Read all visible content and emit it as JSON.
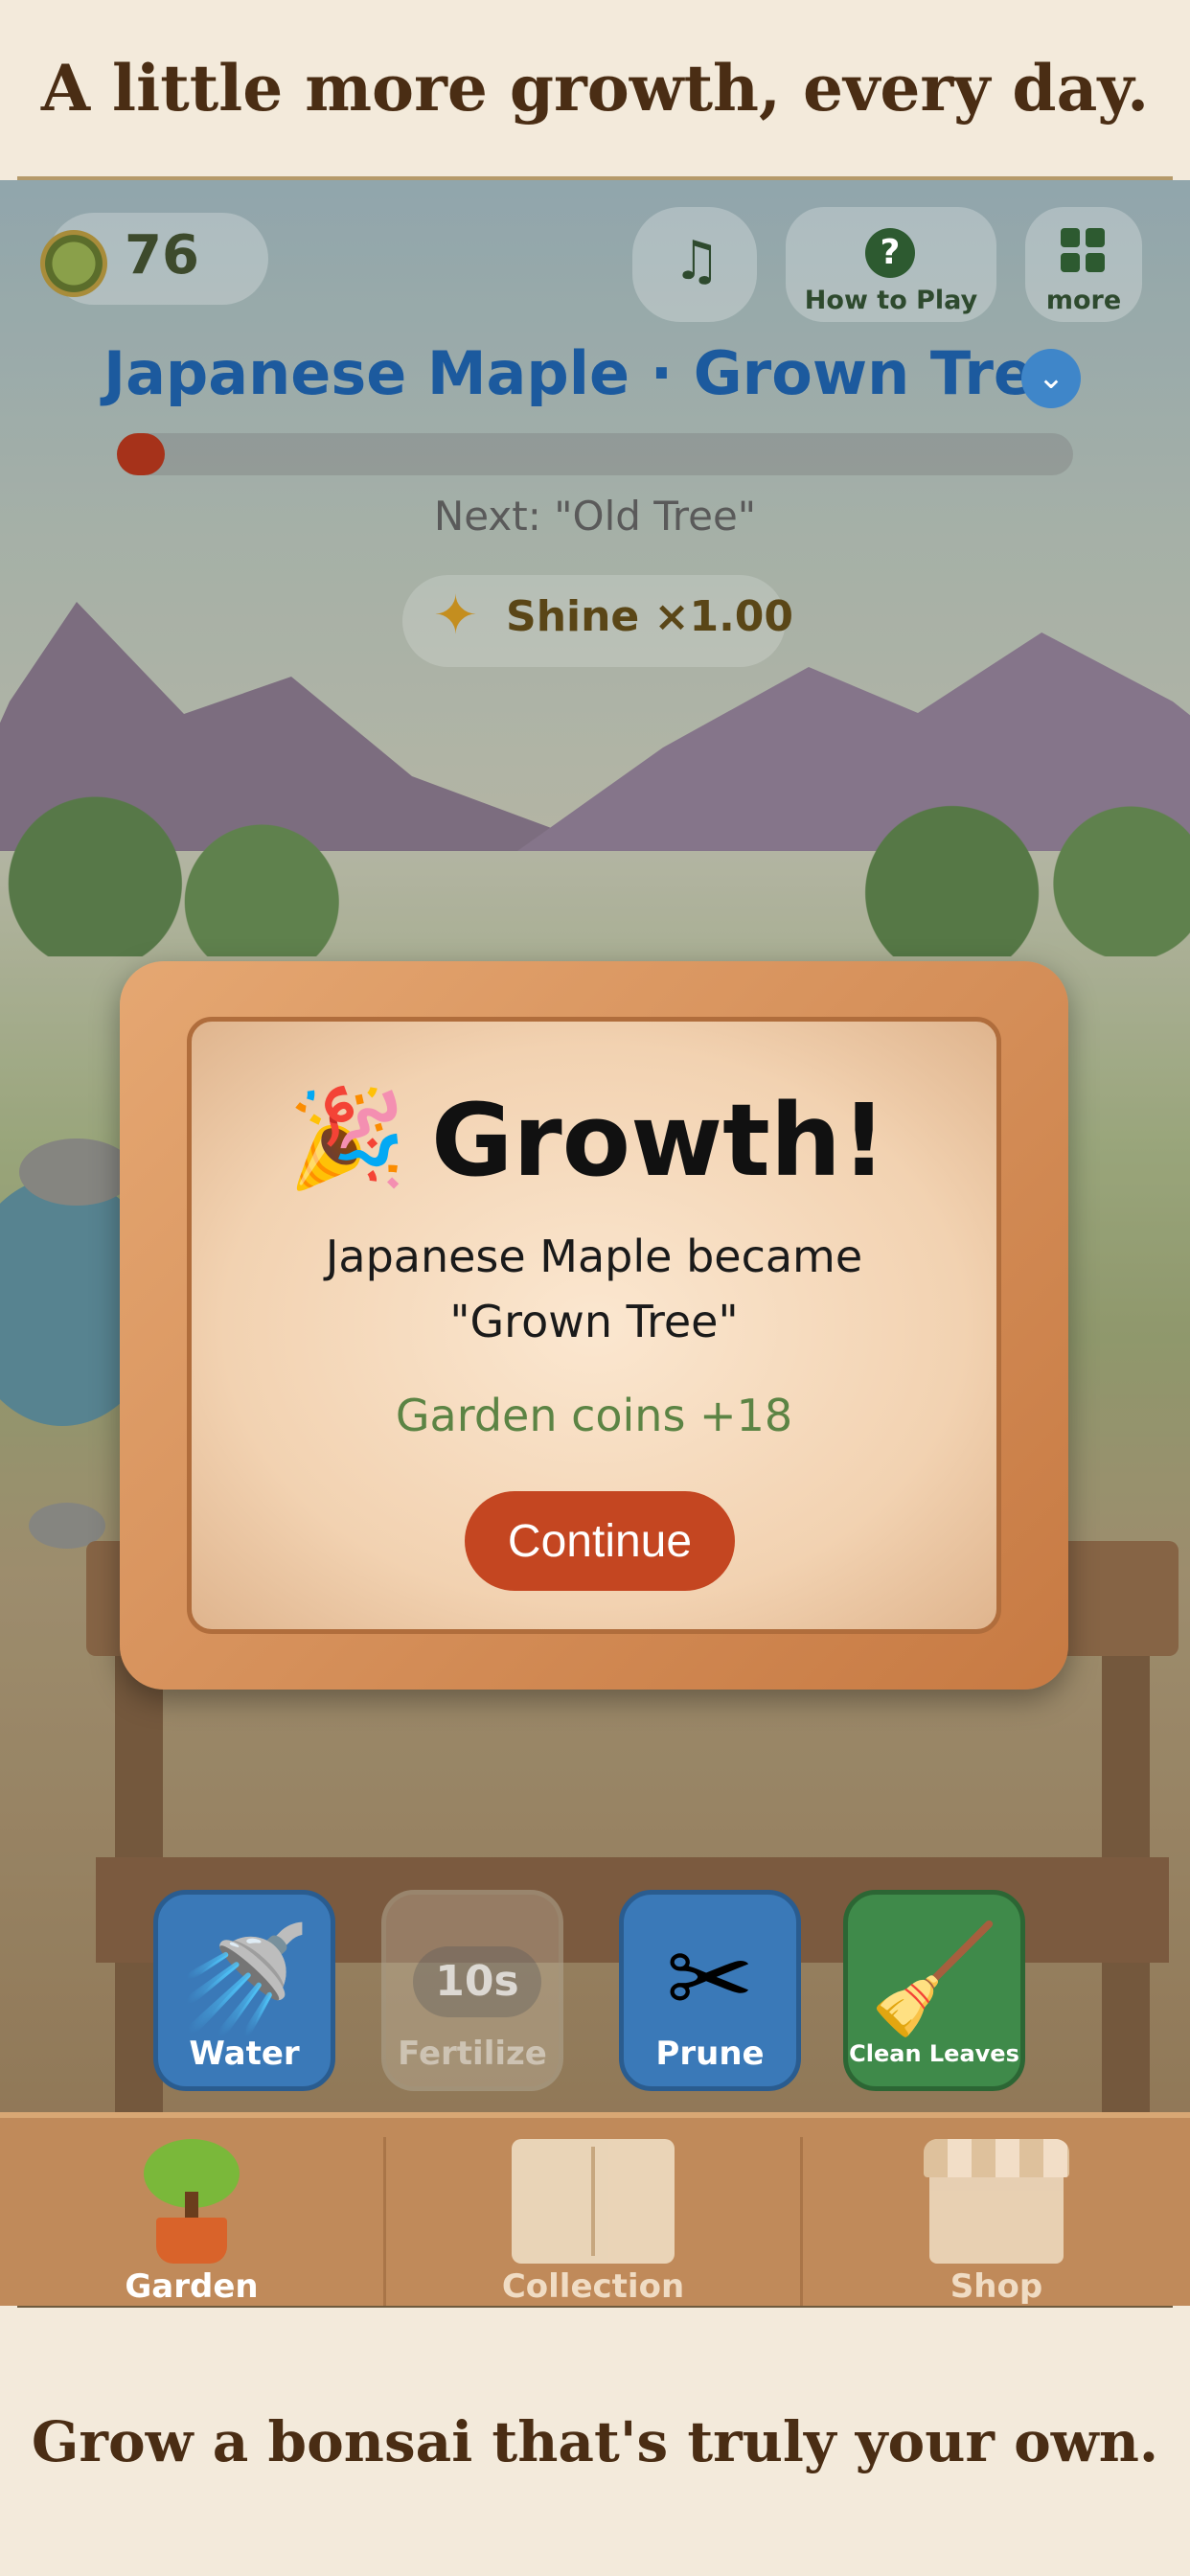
{
  "banners": {
    "top": "A little more growth, every day.",
    "bottom": "Grow a bonsai that's truly your own."
  },
  "hud": {
    "coins": "76",
    "sound_icon": "music-note-icon",
    "how_to_play": "How to Play",
    "more": "more",
    "tree_title": "Japanese Maple · Grown Tree",
    "growth_progress": 0.05,
    "next_stage": "Next: \"Old Tree\"",
    "shine": "Shine ×1.00",
    "shine_icon": "sparkle-icon"
  },
  "modal": {
    "emoji": "🎉",
    "title": "Growth!",
    "message_line1": "Japanese Maple became",
    "message_line2": "\"Grown Tree\"",
    "reward": "Garden coins +18",
    "continue": "Continue"
  },
  "actions": {
    "water": "Water",
    "fertilize": "Fertilize",
    "fertilize_timer": "10s",
    "prune": "Prune",
    "clean_leaves": "Clean Leaves"
  },
  "tabs": {
    "garden": "Garden",
    "collection": "Collection",
    "shop": "Shop"
  },
  "colors": {
    "title_blue": "#1c5a9e",
    "continue_red": "#c44621",
    "reward_green": "#5c8444",
    "tab_bar": "#c08a5a"
  }
}
